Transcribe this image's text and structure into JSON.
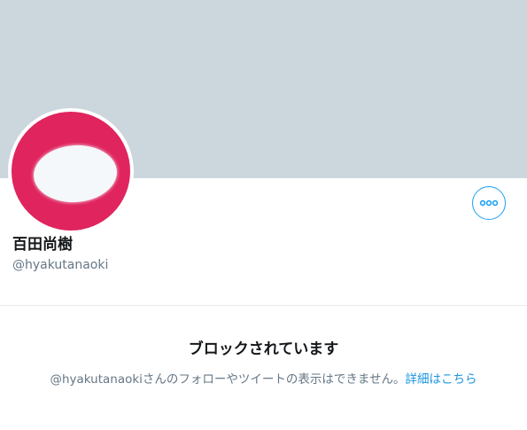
{
  "profile": {
    "display_name": "百田尚樹",
    "handle": "@hyakutanaoki",
    "banner_color": "#ccd6dd",
    "avatar_color": "#e0245e",
    "avatar_icon": "default-egg-icon"
  },
  "actions": {
    "more_icon": "more-options-icon",
    "accent_color": "#1da1f2"
  },
  "blocked": {
    "title": "ブロックされています",
    "description": "@hyakutanaokiさんのフォローやツイートの表示はできません。",
    "link_label": "詳細はこちら",
    "link_color": "#1b95e0"
  }
}
